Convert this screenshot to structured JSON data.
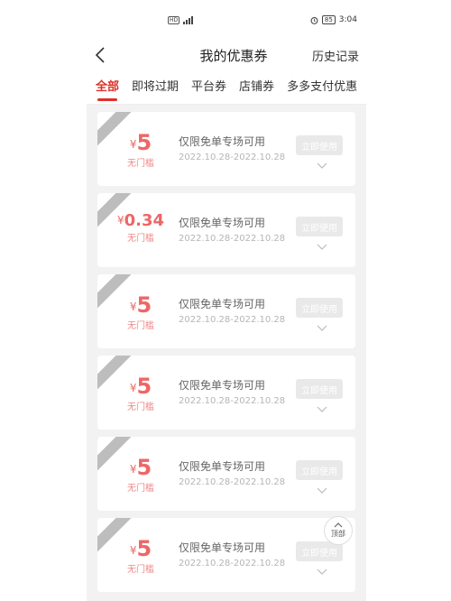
{
  "status": {
    "time": "3:04",
    "battery": "85"
  },
  "nav": {
    "title": "我的优惠券",
    "history": "历史记录"
  },
  "tabs": [
    "全部",
    "即将过期",
    "平台券",
    "店铺券",
    "多多支付优惠"
  ],
  "coupons": [
    {
      "currency": "¥",
      "amount": "5",
      "cond": "无门槛",
      "title": "仅限免单专场可用",
      "date": "2022.10.28-2022.10.28",
      "btn": "立即使用"
    },
    {
      "currency": "¥",
      "amount": "0.34",
      "cond": "无门槛",
      "title": "仅限免单专场可用",
      "date": "2022.10.28-2022.10.28",
      "btn": "立即使用"
    },
    {
      "currency": "¥",
      "amount": "5",
      "cond": "无门槛",
      "title": "仅限免单专场可用",
      "date": "2022.10.28-2022.10.28",
      "btn": "立即使用"
    },
    {
      "currency": "¥",
      "amount": "5",
      "cond": "无门槛",
      "title": "仅限免单专场可用",
      "date": "2022.10.28-2022.10.28",
      "btn": "立即使用"
    },
    {
      "currency": "¥",
      "amount": "5",
      "cond": "无门槛",
      "title": "仅限免单专场可用",
      "date": "2022.10.28-2022.10.28",
      "btn": "立即使用"
    },
    {
      "currency": "¥",
      "amount": "5",
      "cond": "无门槛",
      "title": "仅限免单专场可用",
      "date": "2022.10.28-2022.10.28",
      "btn": "立即使用"
    }
  ],
  "top_button": {
    "label": "顶部"
  },
  "colors": {
    "accent": "#e02e24",
    "amount": "#e66666"
  }
}
